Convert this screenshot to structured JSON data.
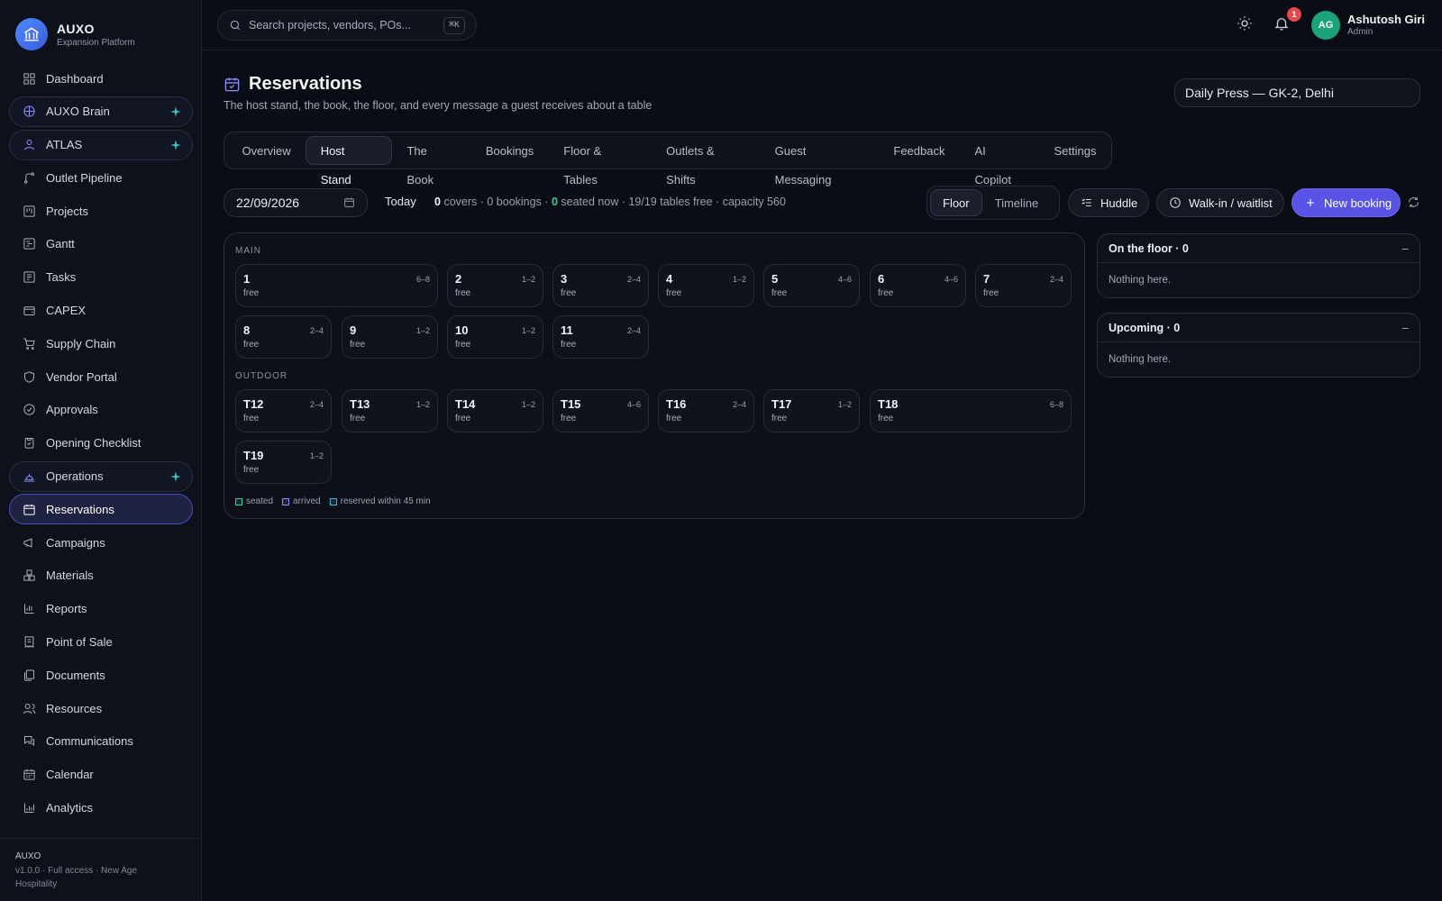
{
  "app": {
    "name": "AUXO",
    "subtitle": "Expansion Platform"
  },
  "sidebar": {
    "items": [
      {
        "label": "Dashboard",
        "icon": "grid-icon"
      },
      {
        "label": "AUXO Brain",
        "icon": "brain-icon"
      },
      {
        "label": "ATLAS",
        "icon": "user-icon"
      },
      {
        "label": "Outlet Pipeline",
        "icon": "route-icon"
      },
      {
        "label": "Projects",
        "icon": "kanban-icon"
      },
      {
        "label": "Gantt",
        "icon": "gantt-icon"
      },
      {
        "label": "Tasks",
        "icon": "tasks-icon"
      },
      {
        "label": "CAPEX",
        "icon": "wallet-icon"
      },
      {
        "label": "Supply Chain",
        "icon": "cart-icon"
      },
      {
        "label": "Vendor Portal",
        "icon": "shield-icon"
      },
      {
        "label": "Approvals",
        "icon": "check-circle-icon"
      },
      {
        "label": "Opening Checklist",
        "icon": "clipboard-icon"
      },
      {
        "label": "Operations",
        "icon": "bell-concierge-icon"
      },
      {
        "label": "Reservations",
        "icon": "calendar-icon"
      },
      {
        "label": "Campaigns",
        "icon": "megaphone-icon"
      },
      {
        "label": "Materials",
        "icon": "boxes-icon"
      },
      {
        "label": "Reports",
        "icon": "bar-chart-icon"
      },
      {
        "label": "Point of Sale",
        "icon": "receipt-icon"
      },
      {
        "label": "Documents",
        "icon": "documents-icon"
      },
      {
        "label": "Resources",
        "icon": "users-icon"
      },
      {
        "label": "Communications",
        "icon": "chat-icon"
      },
      {
        "label": "Calendar",
        "icon": "calendar-days-icon"
      },
      {
        "label": "Analytics",
        "icon": "analytics-icon"
      }
    ],
    "footer": {
      "title": "AUXO",
      "line": "v1.0.0 · Full access · New Age Hospitality"
    }
  },
  "topbar": {
    "search_placeholder": "Search projects, vendors, POs...",
    "shortcut": "⌘K",
    "notification_count": "1",
    "user": {
      "initials": "AG",
      "name": "Ashutosh Giri",
      "role": "Admin"
    }
  },
  "header": {
    "title": "Reservations",
    "subtitle": "The host stand, the book, the floor, and every message a guest receives about a table",
    "outlet": "Daily Press — GK-2, Delhi"
  },
  "tabs": [
    "Overview",
    "Host Stand",
    "The Book",
    "Bookings",
    "Floor & Tables",
    "Outlets & Shifts",
    "Guest Messaging",
    "Feedback",
    "AI Copilot",
    "Settings"
  ],
  "controls": {
    "date": "22/09/2026",
    "today": "Today",
    "stats": {
      "covers": "0",
      "covers_label": "covers ·",
      "bookings": "0 bookings ·",
      "seated": "0",
      "seated_label": "seated now ·",
      "tables": "19/19 tables free ·",
      "capacity": "capacity 560"
    },
    "view_floor": "Floor",
    "view_timeline": "Timeline",
    "huddle": "Huddle",
    "walkin": "Walk-in / waitlist",
    "new_booking": "New booking"
  },
  "floor": {
    "sections": [
      {
        "name": "MAIN",
        "tables": [
          {
            "num": "1",
            "cap": "6–8",
            "status": "free"
          },
          {
            "num": "2",
            "cap": "1–2",
            "status": "free"
          },
          {
            "num": "3",
            "cap": "2–4",
            "status": "free"
          },
          {
            "num": "4",
            "cap": "1–2",
            "status": "free"
          },
          {
            "num": "5",
            "cap": "4–6",
            "status": "free"
          },
          {
            "num": "6",
            "cap": "4–6",
            "status": "free"
          },
          {
            "num": "7",
            "cap": "2–4",
            "status": "free"
          },
          {
            "num": "8",
            "cap": "2–4",
            "status": "free"
          },
          {
            "num": "9",
            "cap": "1–2",
            "status": "free"
          },
          {
            "num": "10",
            "cap": "1–2",
            "status": "free"
          },
          {
            "num": "11",
            "cap": "2–4",
            "status": "free"
          }
        ]
      },
      {
        "name": "OUTDOOR",
        "tables": [
          {
            "num": "T12",
            "cap": "2–4",
            "status": "free"
          },
          {
            "num": "T13",
            "cap": "1–2",
            "status": "free"
          },
          {
            "num": "T14",
            "cap": "1–2",
            "status": "free"
          },
          {
            "num": "T15",
            "cap": "4–6",
            "status": "free"
          },
          {
            "num": "T16",
            "cap": "2–4",
            "status": "free"
          },
          {
            "num": "T17",
            "cap": "1–2",
            "status": "free"
          },
          {
            "num": "T18",
            "cap": "6–8",
            "status": "free"
          },
          {
            "num": "T19",
            "cap": "1–2",
            "status": "free"
          }
        ]
      }
    ],
    "legend": [
      {
        "label": "seated",
        "color": "#2fd0a3"
      },
      {
        "label": "arrived",
        "color": "#8b8ff8"
      },
      {
        "label": "reserved within 45 min",
        "color": "#39b5e0"
      }
    ]
  },
  "panels": [
    {
      "title": "On the floor · 0",
      "toggle": "–",
      "empty": "Nothing here."
    },
    {
      "title": "Upcoming · 0",
      "toggle": "–",
      "empty": "Nothing here."
    }
  ]
}
